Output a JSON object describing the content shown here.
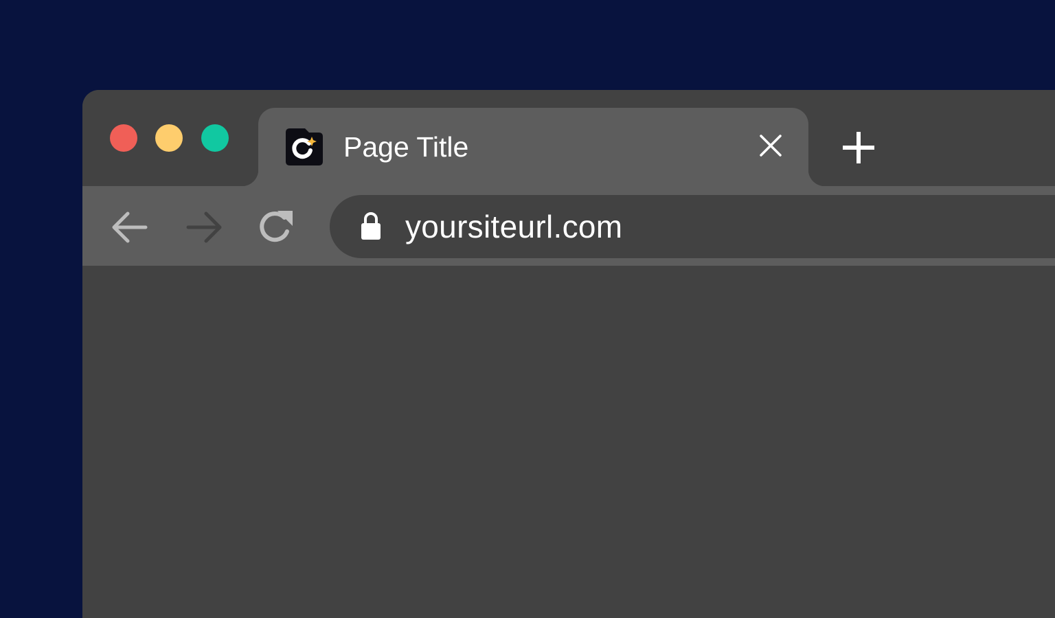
{
  "window": {
    "controls": [
      "close",
      "minimize",
      "maximize"
    ],
    "colors": {
      "close": "#f05f57",
      "minimize": "#fecd6d",
      "maximize": "#11c8a1"
    }
  },
  "tabs": [
    {
      "title": "Page Title",
      "favicon": "refresh-sparkle-favicon-icon",
      "active": true,
      "close_icon": "close-icon"
    }
  ],
  "new_tab_icon": "plus-icon",
  "toolbar": {
    "back_icon": "arrow-left-icon",
    "forward_icon": "arrow-right-icon",
    "reload_icon": "reload-icon"
  },
  "address_bar": {
    "secure_icon": "lock-icon",
    "url": "yoursiteurl.com"
  },
  "theme": {
    "background": "#08133e",
    "frame": "#424242",
    "tab_active": "#5d5d5d",
    "accent": "#f5b73b"
  }
}
